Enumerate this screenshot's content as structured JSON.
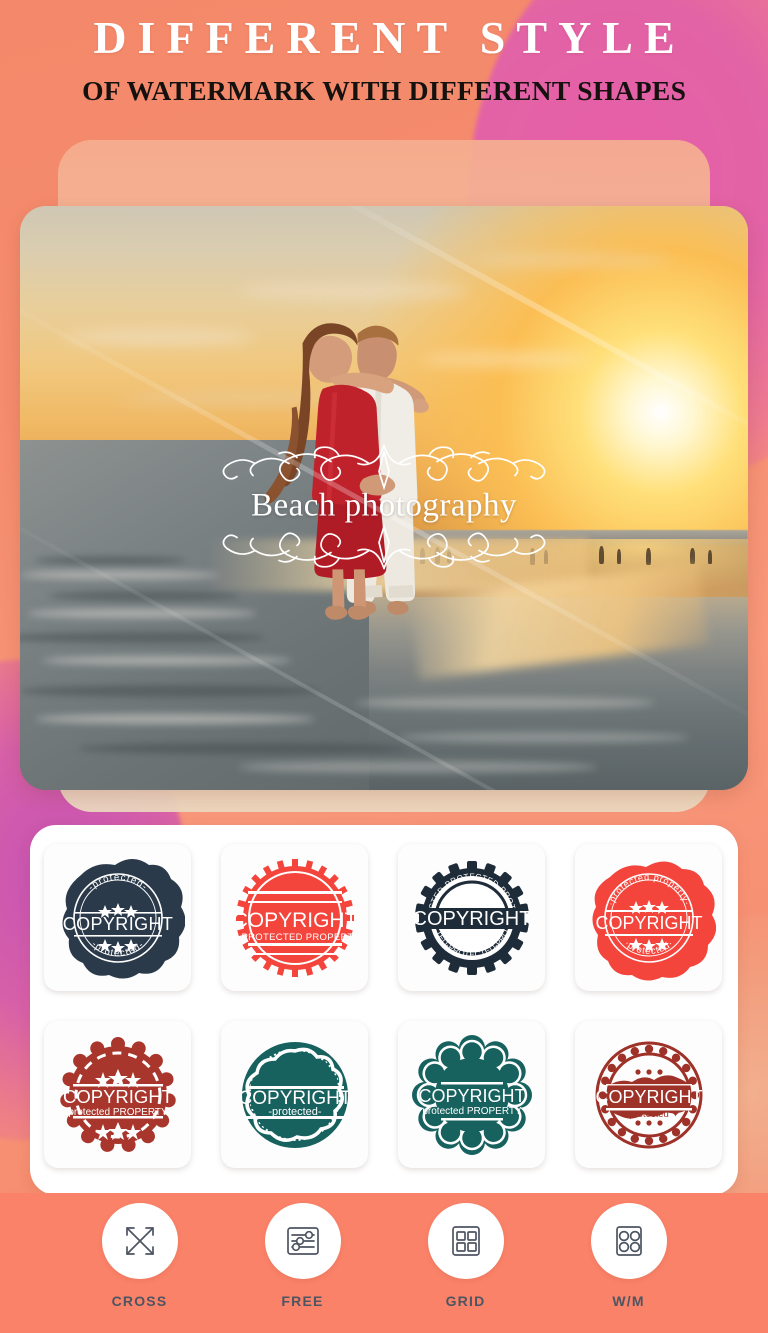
{
  "header": {
    "title": "DIFFERENT STYLE",
    "subtitle": "OF WATERMARK WITH DIFFERENT SHAPES"
  },
  "photo": {
    "alt_name": "beach-sunset-couple-photo",
    "watermark": {
      "text": "Beach photography",
      "ornament_top": "ornament-flourish-top",
      "ornament_bottom": "ornament-flourish-bottom",
      "color": "#FFFFFF"
    }
  },
  "stamps": {
    "items": [
      {
        "id": "stamp-1",
        "shape": "wax-blob-circle",
        "color": "#2B3A4A",
        "main": "COPYRIGHT",
        "top": "-protected-",
        "bottom": "-protected-",
        "stars": "***"
      },
      {
        "id": "stamp-2",
        "shape": "sunburst-circle",
        "color": "#F4453C",
        "main": "COPYRIGHT",
        "top": "",
        "bottom": "PROTECTED PROPERTY",
        "stars": ""
      },
      {
        "id": "stamp-3",
        "shape": "gear-ring-circle",
        "color": "#1E2B38",
        "main": "COPYRIGHT",
        "top": "PROTECTED-PROTECTED-PROTECTED",
        "bottom": "PROTECTED-PROTECTED-PROTECTED",
        "stars": ""
      },
      {
        "id": "stamp-4",
        "shape": "wax-blob-circle",
        "color": "#F4453C",
        "main": "COPYRIGHT",
        "top": "protected property",
        "bottom": "protected",
        "stars": "***"
      },
      {
        "id": "stamp-5",
        "shape": "dashed-scallop-circle",
        "color": "#A8362C",
        "main": "COPYRIGHT",
        "top": "",
        "bottom": "protected PROPERTY",
        "stars": "***"
      },
      {
        "id": "stamp-6",
        "shape": "dotted-wavy-circle",
        "color": "#17625F",
        "main": "COPYRIGHT",
        "top": "",
        "bottom": "-protected-",
        "stars": ""
      },
      {
        "id": "stamp-7",
        "shape": "scalloped-badge",
        "color": "#17625F",
        "main": "COPYRIGHT",
        "top": "",
        "bottom": "protected PROPERTY",
        "stars": ""
      },
      {
        "id": "stamp-8",
        "shape": "beaded-ring-circle",
        "color": "#9E3228",
        "main": "COPYRIGHT",
        "top": "",
        "bottom": "protected",
        "stars": "..."
      }
    ]
  },
  "toolbar": {
    "items": [
      {
        "label": "CROSS",
        "icon": "cross-arrows-icon"
      },
      {
        "label": "FREE",
        "icon": "sliders-icon"
      },
      {
        "label": "GRID",
        "icon": "grid-squares-icon"
      },
      {
        "label": "W/M",
        "icon": "watermark-circles-icon"
      }
    ],
    "background": "#FA8268",
    "label_color": "#4D5562"
  },
  "colors": {
    "coral": "#FA8268",
    "magenta": "#E85FA8",
    "navy": "#2B3A4A",
    "red": "#F4453C",
    "teal": "#17625F",
    "darkred": "#A8362C"
  }
}
